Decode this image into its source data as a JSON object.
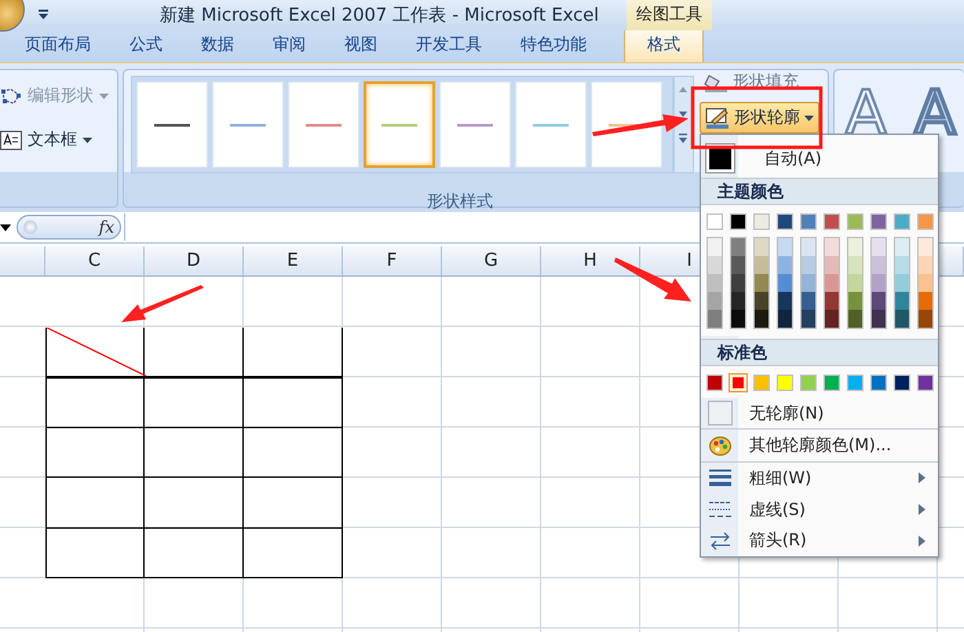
{
  "window": {
    "title": "新建 Microsoft Excel 2007 工作表 - Microsoft Excel",
    "context_group": "绘图工具"
  },
  "tabs": [
    {
      "label": "页面布局",
      "selected": false
    },
    {
      "label": "公式",
      "selected": false
    },
    {
      "label": "数据",
      "selected": false
    },
    {
      "label": "审阅",
      "selected": false
    },
    {
      "label": "视图",
      "selected": false
    },
    {
      "label": "开发工具",
      "selected": false
    },
    {
      "label": "特色功能",
      "selected": false
    },
    {
      "label": "格式",
      "selected": true
    }
  ],
  "ribbon": {
    "insert_group": [
      {
        "label": "编辑形状",
        "disabled": true
      },
      {
        "label": "文本框",
        "disabled": false
      }
    ],
    "shape_styles": {
      "label": "形状样式",
      "styles": [
        {
          "color": "#555555",
          "selected": false
        },
        {
          "color": "#8db3e2",
          "selected": false
        },
        {
          "color": "#e58a8a",
          "selected": false
        },
        {
          "color": "#b3cf7a",
          "selected": true
        },
        {
          "color": "#b49ac9",
          "selected": false
        },
        {
          "color": "#8ecde0",
          "selected": false
        },
        {
          "color": "#f9c08f",
          "selected": false
        }
      ]
    },
    "fill_button": "形状填充",
    "outline_button": "形状轮廓",
    "wordart_samples": [
      "A",
      "A"
    ]
  },
  "formula_bar": {
    "function_button": "fx"
  },
  "columns": [
    "C",
    "D",
    "E",
    "F",
    "G",
    "H",
    "I"
  ],
  "sheet_table": {
    "diagonal_in_first_cell": true
  },
  "outline_menu": {
    "automatic": {
      "label": "自动(A)",
      "color": "#000000"
    },
    "theme_header": "主题颜色",
    "theme_colors": [
      {
        "color": "#ffffff",
        "shades": [
          {
            "color": "#f2f2f2"
          },
          {
            "color": "#d8d8d8"
          },
          {
            "color": "#bfbfbf"
          },
          {
            "color": "#a5a5a5"
          },
          {
            "color": "#7f7f7f"
          }
        ]
      },
      {
        "color": "#000000",
        "shades": [
          {
            "color": "#7f7f7f"
          },
          {
            "color": "#595959"
          },
          {
            "color": "#3f3f3f"
          },
          {
            "color": "#262626"
          },
          {
            "color": "#0c0c0c"
          }
        ]
      },
      {
        "color": "#eeece1",
        "shades": [
          {
            "color": "#ddd9c3"
          },
          {
            "color": "#c4bd97"
          },
          {
            "color": "#938953"
          },
          {
            "color": "#494429"
          },
          {
            "color": "#1d1b10"
          }
        ]
      },
      {
        "color": "#1f497d",
        "shades": [
          {
            "color": "#c6d9f0"
          },
          {
            "color": "#8db3e2"
          },
          {
            "color": "#548dd4"
          },
          {
            "color": "#17365d"
          },
          {
            "color": "#0f243e"
          }
        ]
      },
      {
        "color": "#4f81bd",
        "shades": [
          {
            "color": "#dbe5f1"
          },
          {
            "color": "#b8cce4"
          },
          {
            "color": "#95b3d7"
          },
          {
            "color": "#366092"
          },
          {
            "color": "#244061"
          }
        ]
      },
      {
        "color": "#c0504d",
        "shades": [
          {
            "color": "#f2dcdb"
          },
          {
            "color": "#e5b9b7"
          },
          {
            "color": "#d99694"
          },
          {
            "color": "#953734"
          },
          {
            "color": "#632423"
          }
        ]
      },
      {
        "color": "#9bbb59",
        "shades": [
          {
            "color": "#ebf1dd"
          },
          {
            "color": "#d7e3bc"
          },
          {
            "color": "#c3d69b"
          },
          {
            "color": "#76923c"
          },
          {
            "color": "#4f6128"
          }
        ]
      },
      {
        "color": "#8064a2",
        "shades": [
          {
            "color": "#e5e0ec"
          },
          {
            "color": "#ccc1d9"
          },
          {
            "color": "#b2a2c7"
          },
          {
            "color": "#5f497a"
          },
          {
            "color": "#3f3151"
          }
        ]
      },
      {
        "color": "#4bacc6",
        "shades": [
          {
            "color": "#dbeef3"
          },
          {
            "color": "#b7dde8"
          },
          {
            "color": "#92cddc"
          },
          {
            "color": "#31859b"
          },
          {
            "color": "#205867"
          }
        ]
      },
      {
        "color": "#f79646",
        "shades": [
          {
            "color": "#fdeada"
          },
          {
            "color": "#fbd5b5"
          },
          {
            "color": "#fac08f"
          },
          {
            "color": "#e36c09"
          },
          {
            "color": "#974806"
          }
        ]
      }
    ],
    "standard_header": "标准色",
    "standard_colors": [
      {
        "color": "#c00000",
        "selected": false
      },
      {
        "color": "#ff0000",
        "selected": true
      },
      {
        "color": "#ffc000",
        "selected": false
      },
      {
        "color": "#ffff00",
        "selected": false
      },
      {
        "color": "#92d050",
        "selected": false
      },
      {
        "color": "#00b050",
        "selected": false
      },
      {
        "color": "#00b0f0",
        "selected": false
      },
      {
        "color": "#0070c0",
        "selected": false
      },
      {
        "color": "#002060",
        "selected": false
      },
      {
        "color": "#7030a0",
        "selected": false
      }
    ],
    "items": [
      {
        "kind": "no-outline",
        "label": "无轮廓(N)",
        "submenu": false
      },
      {
        "kind": "more-colors",
        "label": "其他轮廓颜色(M)...",
        "submenu": false
      },
      {
        "kind": "weight",
        "label": "粗细(W)",
        "submenu": true
      },
      {
        "kind": "dashes",
        "label": "虚线(S)",
        "submenu": true
      },
      {
        "kind": "arrows",
        "label": "箭头(R)",
        "submenu": true
      }
    ]
  }
}
